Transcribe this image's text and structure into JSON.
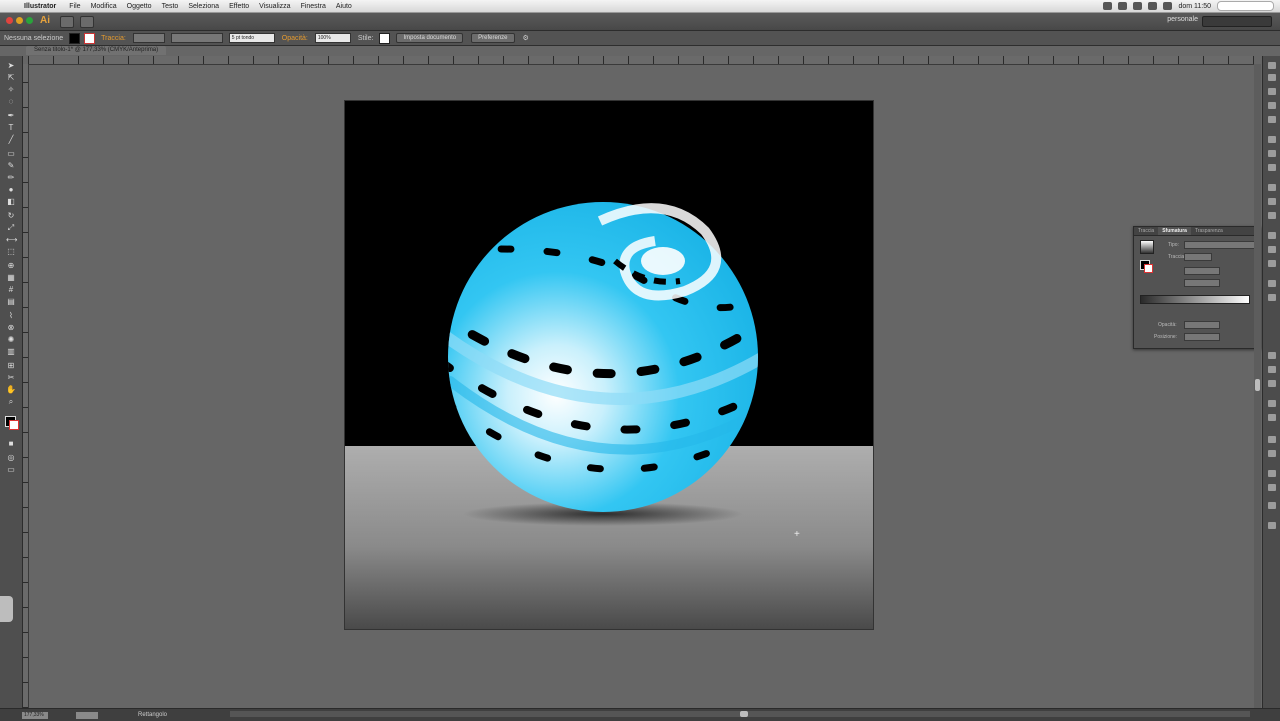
{
  "menubar": {
    "app_name": "Illustrator",
    "items": [
      "File",
      "Modifica",
      "Oggetto",
      "Testo",
      "Seleziona",
      "Effetto",
      "Visualizza",
      "Finestra",
      "Aiuto"
    ],
    "clock": "dom 11:50"
  },
  "appbar": {
    "logo": "Ai",
    "workspace": "personale"
  },
  "controlbar": {
    "selection_label": "Nessuna selezione",
    "stroke_label": "Traccia:",
    "brush_value": "5 pt tondo",
    "opacity_label": "Opacità:",
    "opacity_value": "100%",
    "style_label": "Stile:",
    "doc_setup_button": "Imposta documento",
    "preferences_button": "Preferenze"
  },
  "document": {
    "tab_title": "Senza titolo-1* @ 177,33% (CMYK/Anteprima)"
  },
  "artwork": {
    "sphere_color": "#33c6f2",
    "highlight_color": "#ffffff",
    "shadow_color": "#1a1a1a"
  },
  "gradient_panel": {
    "tabs": [
      "Traccia",
      "Sfumatura",
      "Trasparenza"
    ],
    "type_label": "Tipo:",
    "stroke_label": "Traccia:",
    "opacity_label": "Opacità:",
    "position_label": "Posizione:"
  },
  "statusbar": {
    "zoom": "177,33%",
    "page": "1",
    "current_tool": "Rettangolo"
  }
}
